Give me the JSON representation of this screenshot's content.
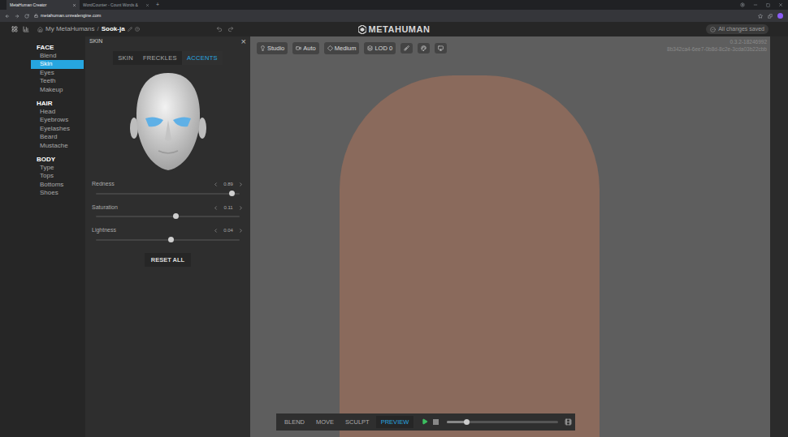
{
  "browser": {
    "tabs": [
      {
        "label": "MetaHuman Creator",
        "selected": true
      },
      {
        "label": "WordCounter - Count Words &",
        "selected": false
      }
    ],
    "new_tab": "+",
    "url": "metahuman.unrealengine.com"
  },
  "header": {
    "root": "My MetaHumans",
    "separator": "/",
    "name": "Sook-ja",
    "logo": "METAHUMAN",
    "status": "All changes saved"
  },
  "nav": [
    {
      "title": "FACE",
      "items": [
        {
          "label": "Blend",
          "selected": false
        },
        {
          "label": "Skin",
          "selected": true
        },
        {
          "label": "Eyes",
          "selected": false
        },
        {
          "label": "Teeth",
          "selected": false
        },
        {
          "label": "Makeup",
          "selected": false
        }
      ]
    },
    {
      "title": "HAIR",
      "items": [
        {
          "label": "Head",
          "selected": false
        },
        {
          "label": "Eyebrows",
          "selected": false
        },
        {
          "label": "Eyelashes",
          "selected": false
        },
        {
          "label": "Beard",
          "selected": false
        },
        {
          "label": "Mustache",
          "selected": false
        }
      ]
    },
    {
      "title": "BODY",
      "items": [
        {
          "label": "Type",
          "selected": false
        },
        {
          "label": "Tops",
          "selected": false
        },
        {
          "label": "Bottoms",
          "selected": false
        },
        {
          "label": "Shoes",
          "selected": false
        }
      ]
    }
  ],
  "panel": {
    "title": "SKIN",
    "close": "×",
    "tabs": [
      {
        "label": "SKIN",
        "selected": false
      },
      {
        "label": "FRECKLES",
        "selected": false
      },
      {
        "label": "ACCENTS",
        "selected": true
      }
    ],
    "sliders": [
      {
        "label": "Redness",
        "value": "0.89",
        "level": 0.945
      },
      {
        "label": "Saturation",
        "value": "0.11",
        "level": 0.555
      },
      {
        "label": "Lightness",
        "value": "0.04",
        "level": 0.52
      }
    ],
    "reset": "RESET ALL"
  },
  "viewport": {
    "toolbar": [
      {
        "label": "Studio"
      },
      {
        "label": "Auto"
      },
      {
        "label": "Medium"
      },
      {
        "label": "LOD 0"
      }
    ],
    "version": "0.3.2-18246992",
    "id": "8b342ca4-6ee7-0b8d-8c2e-3cda03b22cbb",
    "modes": [
      {
        "label": "BLEND",
        "selected": false
      },
      {
        "label": "MOVE",
        "selected": false
      },
      {
        "label": "SCULPT",
        "selected": false
      },
      {
        "label": "PREVIEW",
        "selected": true
      }
    ],
    "timeline": {
      "level": 0.175
    }
  }
}
